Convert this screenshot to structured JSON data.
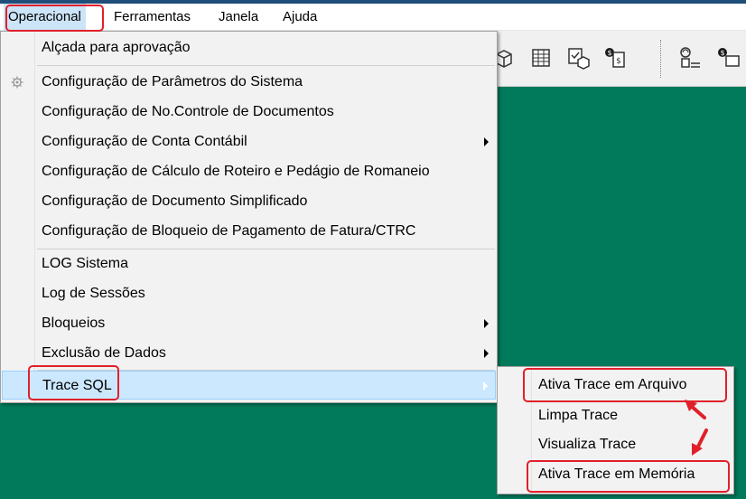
{
  "menubar": {
    "items": [
      "Operacional",
      "Ferramentas",
      "Janela",
      "Ajuda"
    ]
  },
  "toolbar": {
    "icons": [
      "package-arrow-icon",
      "spreadsheet-icon",
      "package-check-icon",
      "money-document-icon",
      "transfer-icon",
      "money-truck-icon"
    ]
  },
  "operacional_menu": {
    "items": [
      {
        "label": "Alçada para aprovação",
        "submenu": false
      },
      {
        "label": "Configuração de Parâmetros do Sistema",
        "submenu": false,
        "icon": "gear-icon"
      },
      {
        "label": "Configuração de No.Controle de Documentos",
        "submenu": false
      },
      {
        "label": "Configuração de Conta Contábil",
        "submenu": true
      },
      {
        "label": "Configuração de Cálculo de Roteiro e Pedágio de Romaneio",
        "submenu": false
      },
      {
        "label": "Configuração de Documento Simplificado",
        "submenu": false
      },
      {
        "label": "Configuração de Bloqueio de Pagamento de Fatura/CTRC",
        "submenu": false
      },
      {
        "label": "LOG Sistema",
        "submenu": false
      },
      {
        "label": "Log de Sessões",
        "submenu": false
      },
      {
        "label": "Bloqueios",
        "submenu": true
      },
      {
        "label": "Exclusão de Dados",
        "submenu": true
      },
      {
        "label": "Trace SQL",
        "submenu": true,
        "highlighted": true
      }
    ]
  },
  "trace_sql_submenu": {
    "items": [
      {
        "label": "Ativa Trace em Arquivo",
        "highlighted": true
      },
      {
        "label": "Limpa Trace"
      },
      {
        "label": "Visualiza Trace"
      },
      {
        "label": "Ativa Trace em Memória",
        "highlighted": true
      }
    ]
  },
  "colors": {
    "workspace": "#017a5b",
    "annotation": "#e0202a",
    "hover": "#cce8ff",
    "menubar_active": "#cce4f7"
  }
}
